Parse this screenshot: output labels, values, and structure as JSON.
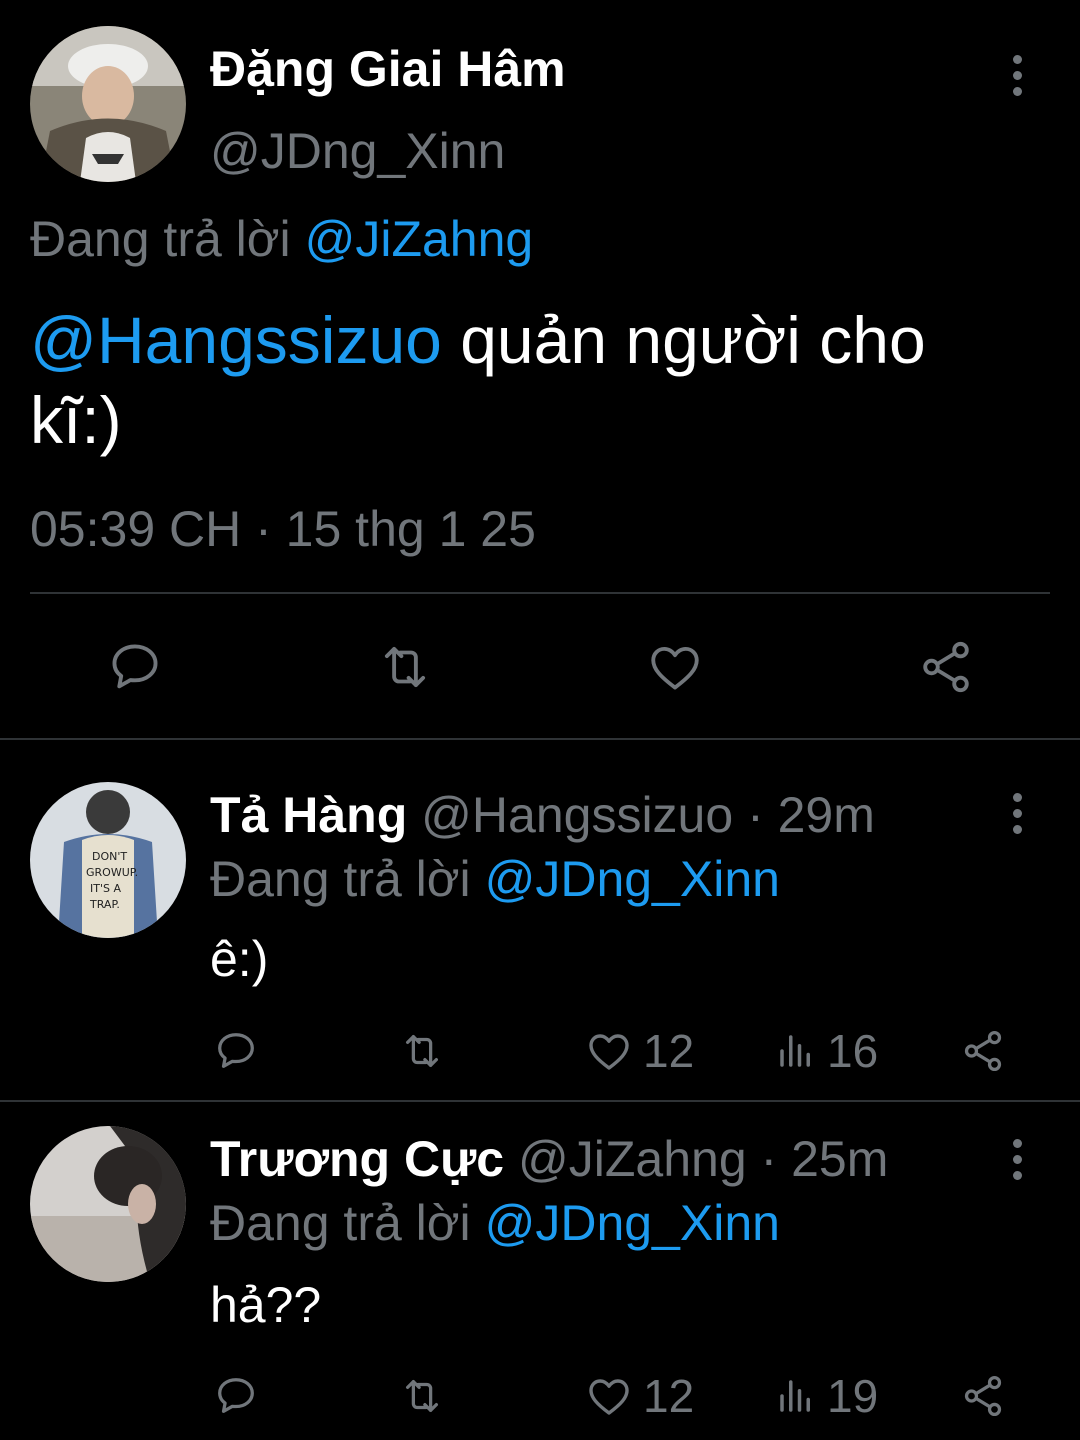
{
  "main_tweet": {
    "author_name": "Đặng Giai Hâm",
    "author_handle": "@JDng_Xinn",
    "reply_prefix": "Đang trả lời",
    "reply_to": "@JiZahng",
    "mention": "@Hangssizuo",
    "text": " quản người cho kĩ:)",
    "timestamp": "05:39 CH · 15 thg 1 25"
  },
  "replies": [
    {
      "author_name": "Tả Hàng",
      "author_handle": "@Hangssizuo",
      "time": "· 29m",
      "reply_prefix": "Đang trả lời",
      "reply_to": "@JDng_Xinn",
      "text": "ê:)",
      "likes": "12",
      "views": "16"
    },
    {
      "author_name": "Trương Cực",
      "author_handle": "@JiZahng",
      "time": "· 25m",
      "reply_prefix": "Đang trả lời",
      "reply_to": "@JDng_Xinn",
      "text": "hả??",
      "likes": "12",
      "views": "19"
    }
  ],
  "colors": {
    "background": "#000000",
    "text": "#e7e9ea",
    "muted": "#71767b",
    "link": "#1d9bf0",
    "divider": "#2f3336"
  },
  "icons": [
    "reply-icon",
    "retweet-icon",
    "like-icon",
    "share-icon",
    "views-icon",
    "more-icon"
  ]
}
